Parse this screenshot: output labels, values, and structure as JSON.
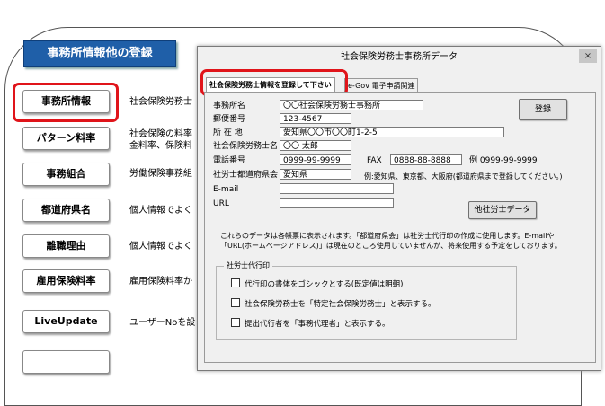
{
  "background": {
    "header_title": "事務所情報他の登録",
    "menu": [
      {
        "label": "事務所情報",
        "desc": "社会保険労務士"
      },
      {
        "label": "パターン料率",
        "desc": "社会保険の料率\n金料率、保険料"
      },
      {
        "label": "事務組合",
        "desc": "労働保険事務組"
      },
      {
        "label": "都道府県名",
        "desc": "個人情報でよく"
      },
      {
        "label": "離職理由",
        "desc": "個人情報でよく"
      },
      {
        "label": "雇用保険料率",
        "desc": "雇用保険料率か"
      },
      {
        "label": "LiveUpdate",
        "desc": "ユーザーNoを設"
      }
    ]
  },
  "dialog": {
    "title": "社会保険労務士事務所データ",
    "close": "×",
    "tabs": [
      "社会保険労務士情報を登録して下さい",
      "e-Gov 電子申請関連"
    ],
    "register_button": "登録",
    "other_sharoushi_button": "他社労士データ",
    "fields": {
      "office_name": {
        "label": "事務所名",
        "value": "〇〇社会保険労務士事務所"
      },
      "postal": {
        "label": "郵便番号",
        "value": "123-4567"
      },
      "address": {
        "label": "所 在 地",
        "value": "愛知県〇〇市〇〇町1-2-5"
      },
      "sharoushi_name": {
        "label": "社会保険労務士名",
        "value": "〇〇 太郎"
      },
      "phone": {
        "label": "電話番号",
        "value": "0999-99-9999"
      },
      "fax": {
        "label": "FAX",
        "value": "0888-88-8888"
      },
      "example_phone": "例 0999-99-9999",
      "pref_assoc": {
        "label": "社労士都道府県会",
        "value": "愛知県"
      },
      "pref_example": "例:愛知県、東京都、大阪府(都道府県まで登録してください。)",
      "email": {
        "label": "E-mail",
        "value": ""
      },
      "url": {
        "label": "URL",
        "value": ""
      }
    },
    "note": "これらのデータは各帳票に表示されます。「都道府県会」は社労士代行印の作成に使用します。E-mailや「URL(ホームページアドレス)」は現在のところ使用していませんが、将来使用する予定をしております。",
    "group": {
      "title": "社労士代行印",
      "options": [
        "代行印の書体をゴシックとする(既定値は明朝)",
        "社会保険労務士を「特定社会保険労務士」と表示する。",
        "提出代行者を「事務代理者」と表示する。"
      ]
    }
  }
}
